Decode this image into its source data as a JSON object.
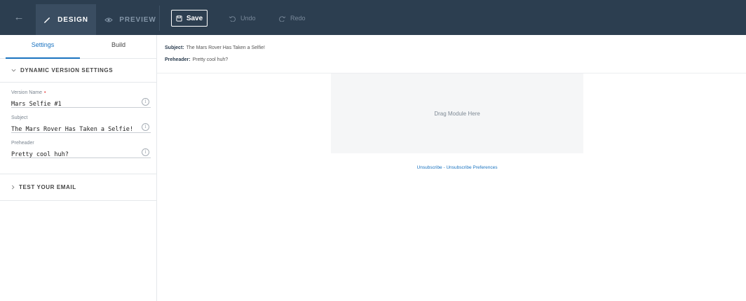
{
  "topbar": {
    "back_icon": "←",
    "design_label": "DESIGN",
    "preview_label": "PREVIEW",
    "save_label": "Save",
    "undo_label": "Undo",
    "redo_label": "Redo"
  },
  "left": {
    "tabs": [
      "Settings",
      "Build"
    ],
    "dynamic_section_title": "DYNAMIC VERSION SETTINGS",
    "fields": [
      {
        "label": "Version Name",
        "required": "•",
        "value": "Mars Selfie #1"
      },
      {
        "label": "Subject",
        "value": "The Mars Rover Has Taken a Selfie!"
      },
      {
        "label": "Preheader",
        "value": "Pretty cool huh?"
      }
    ],
    "test_section_title": "TEST YOUR EMAIL"
  },
  "main": {
    "subject_key": "Subject:",
    "subject_value": "The Mars Rover Has Taken a Selfie!",
    "preheader_key": "Preheader:",
    "preheader_value": "Pretty cool huh?",
    "dropzone_text": "Drag Module Here",
    "unsubscribe_label": "Unsubscribe",
    "separator": " - ",
    "preferences_label": "Unsubscribe Preferences"
  },
  "colors": {
    "topbar_bg": "#2c3e50",
    "accent": "#1a73c0"
  }
}
